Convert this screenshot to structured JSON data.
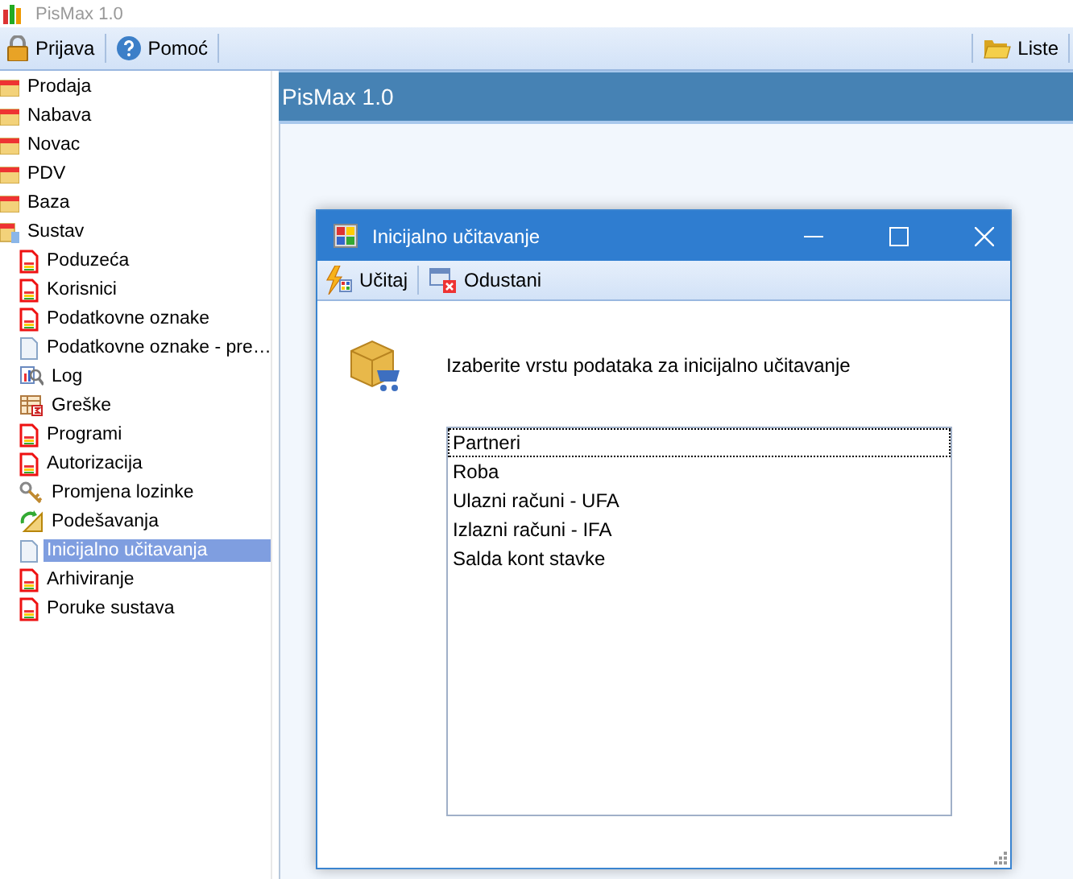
{
  "window": {
    "title": "PisMax 1.0"
  },
  "toolbar": {
    "left": [
      {
        "label": "Prijava",
        "kind": "lock"
      },
      {
        "label": "Pomoć",
        "kind": "help"
      }
    ],
    "right": [
      {
        "label": "Liste",
        "kind": "folder"
      }
    ]
  },
  "sidebar": {
    "items": [
      {
        "label": "Prodaja",
        "kind": "folder",
        "selected": false
      },
      {
        "label": "Nabava",
        "kind": "folder",
        "selected": false
      },
      {
        "label": "Novac",
        "kind": "folder",
        "selected": false
      },
      {
        "label": "PDV",
        "kind": "folder",
        "selected": false
      },
      {
        "label": "Baza",
        "kind": "folder",
        "selected": false
      },
      {
        "label": "Sustav",
        "kind": "openfolder",
        "selected": false,
        "children": [
          {
            "label": "Poduzeća",
            "kind": "report",
            "selected": false
          },
          {
            "label": "Korisnici",
            "kind": "report",
            "selected": false
          },
          {
            "label": "Podatkovne oznake",
            "kind": "report",
            "selected": false
          },
          {
            "label": "Podatkovne oznake - pre…",
            "kind": "blank",
            "selected": false
          },
          {
            "label": "Log",
            "kind": "log",
            "selected": false
          },
          {
            "label": "Greške",
            "kind": "table",
            "selected": false
          },
          {
            "label": "Programi",
            "kind": "report",
            "selected": false
          },
          {
            "label": "Autorizacija",
            "kind": "report",
            "selected": false
          },
          {
            "label": "Promjena lozinke",
            "kind": "key",
            "selected": false
          },
          {
            "label": "Podešavanja",
            "kind": "settings",
            "selected": false
          },
          {
            "label": "Inicijalno učitavanja",
            "kind": "blank",
            "selected": true
          },
          {
            "label": "Arhiviranje",
            "kind": "report",
            "selected": false
          },
          {
            "label": "Poruke sustava",
            "kind": "report",
            "selected": false
          }
        ]
      }
    ]
  },
  "header": {
    "title": "PisMax 1.0"
  },
  "dialog": {
    "title": "Inicijalno učitavanje",
    "toolbar": [
      {
        "label": "Učitaj",
        "kind": "load"
      },
      {
        "label": "Odustani",
        "kind": "cancel"
      }
    ],
    "prompt": "Izaberite vrstu podataka za inicijalno učitavanje",
    "list": [
      {
        "label": "Partneri",
        "focused": true
      },
      {
        "label": "Roba",
        "focused": false
      },
      {
        "label": "Ulazni računi - UFA",
        "focused": false
      },
      {
        "label": "Izlazni računi - IFA",
        "focused": false
      },
      {
        "label": "Salda kont stavke",
        "focused": false
      }
    ]
  }
}
